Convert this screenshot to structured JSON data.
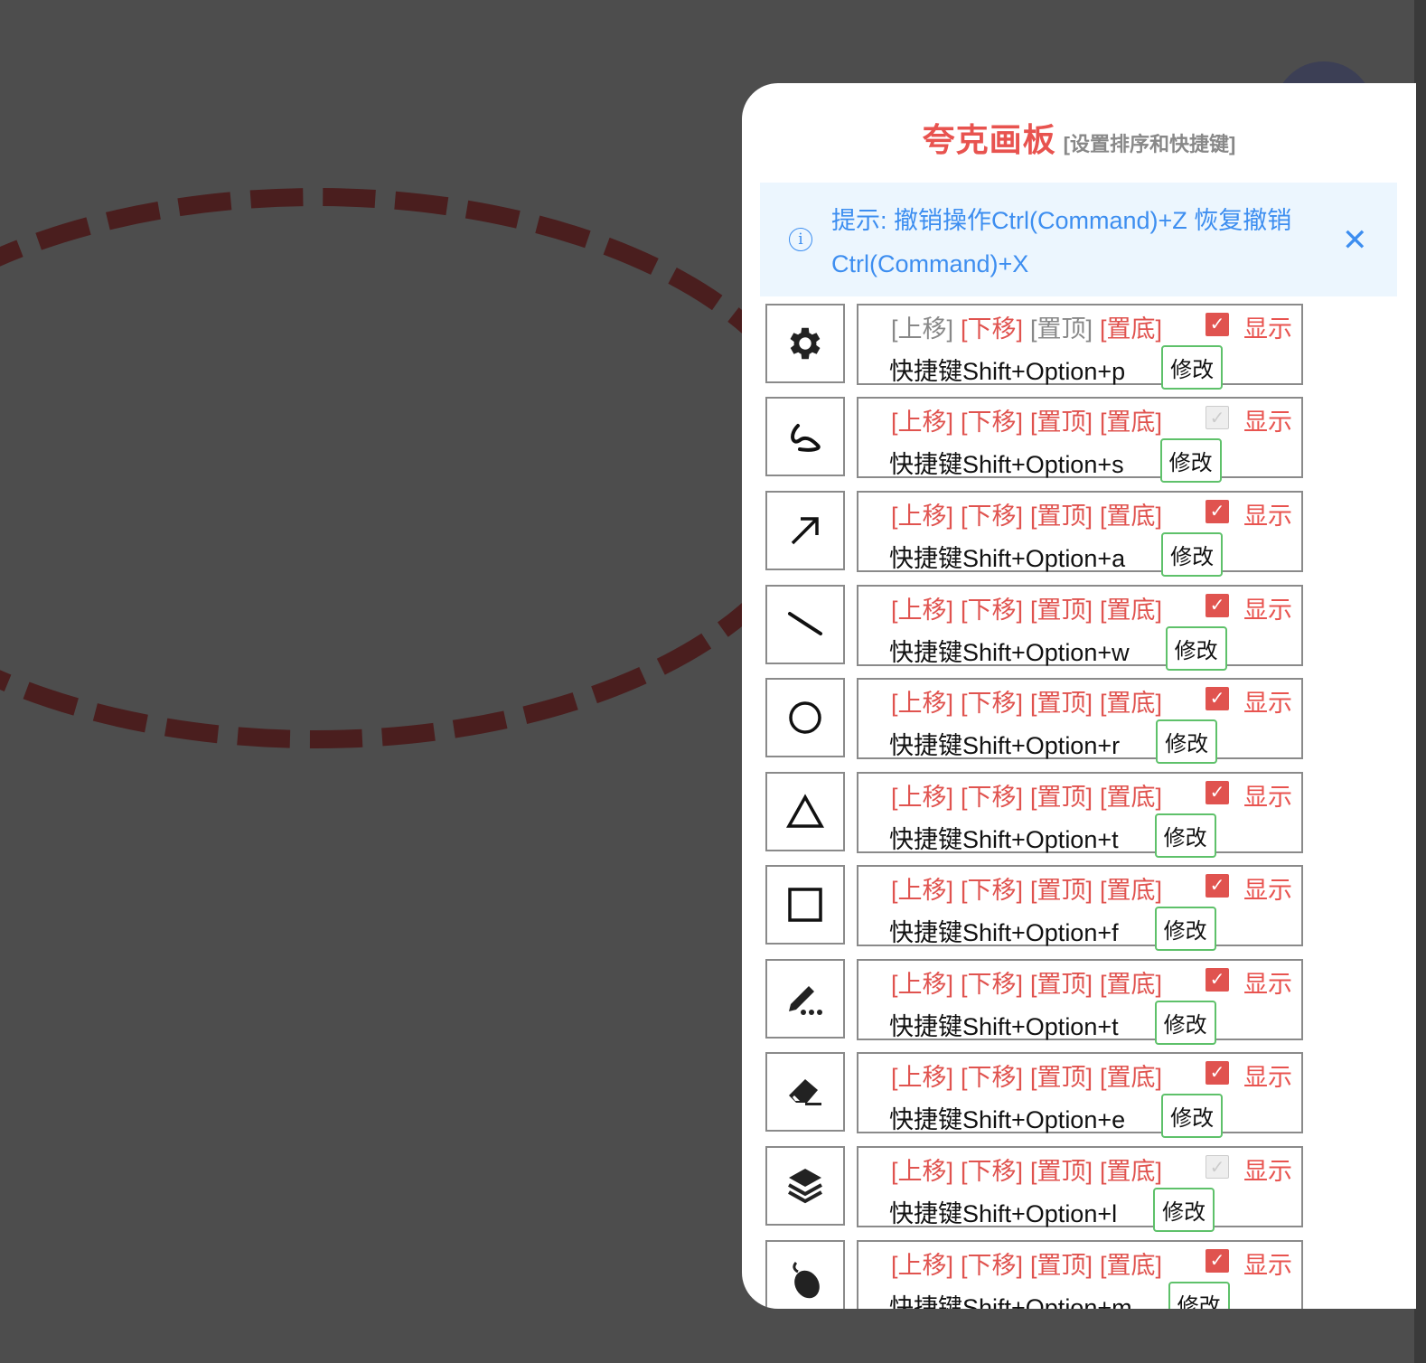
{
  "panel": {
    "title": "夸克画板",
    "subtitle": "[设置排序和快捷键]"
  },
  "tip": {
    "text": "提示: 撤销操作Ctrl(Command)+Z 恢复撤销Ctrl(Command)+X"
  },
  "labels": {
    "up": "[上移]",
    "down": "[下移]",
    "top": "[置顶]",
    "bottom": "[置底]",
    "show": "显示",
    "modify": "修改"
  },
  "colors": {
    "accent": "#e8534f",
    "tip": "#3d8ef0",
    "button_border": "#5ec16a"
  },
  "tools": [
    {
      "icon": "gear-icon",
      "shortcut": "快捷键Shift+Option+p",
      "visible": true
    },
    {
      "icon": "freehand-icon",
      "shortcut": "快捷键Shift+Option+s",
      "visible": false
    },
    {
      "icon": "arrow-icon",
      "shortcut": "快捷键Shift+Option+a",
      "visible": true
    },
    {
      "icon": "line-icon",
      "shortcut": "快捷键Shift+Option+w",
      "visible": true
    },
    {
      "icon": "circle-icon",
      "shortcut": "快捷键Shift+Option+r",
      "visible": true
    },
    {
      "icon": "triangle-icon",
      "shortcut": "快捷键Shift+Option+t",
      "visible": true
    },
    {
      "icon": "square-icon",
      "shortcut": "快捷键Shift+Option+f",
      "visible": true
    },
    {
      "icon": "pencil-text-icon",
      "shortcut": "快捷键Shift+Option+t",
      "visible": true
    },
    {
      "icon": "eraser-icon",
      "shortcut": "快捷键Shift+Option+e",
      "visible": true
    },
    {
      "icon": "layers-icon",
      "shortcut": "快捷键Shift+Option+l",
      "visible": false
    },
    {
      "icon": "mouse-icon",
      "shortcut": "快捷键Shift+Option+m",
      "visible": true
    }
  ]
}
